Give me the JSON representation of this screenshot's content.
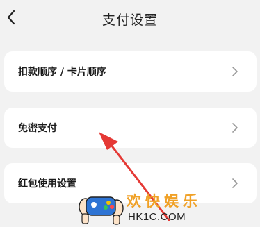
{
  "header": {
    "title": "支付设置",
    "back_icon": "chevron-left-icon"
  },
  "menu": {
    "items": [
      {
        "label": "扣款顺序 / 卡片顺序",
        "icon": "chevron-right-icon"
      },
      {
        "label": "免密支付",
        "icon": "chevron-right-icon"
      },
      {
        "label": "红包使用设置",
        "icon": "chevron-right-icon"
      }
    ]
  },
  "annotation": {
    "color": "#e53935"
  },
  "watermark": {
    "text_cn": "欢快娱乐",
    "text_en": "HK1C.COM"
  },
  "colors": {
    "background": "#f2f2f2",
    "card": "#ffffff",
    "watermark_orange": "#f0a127"
  }
}
